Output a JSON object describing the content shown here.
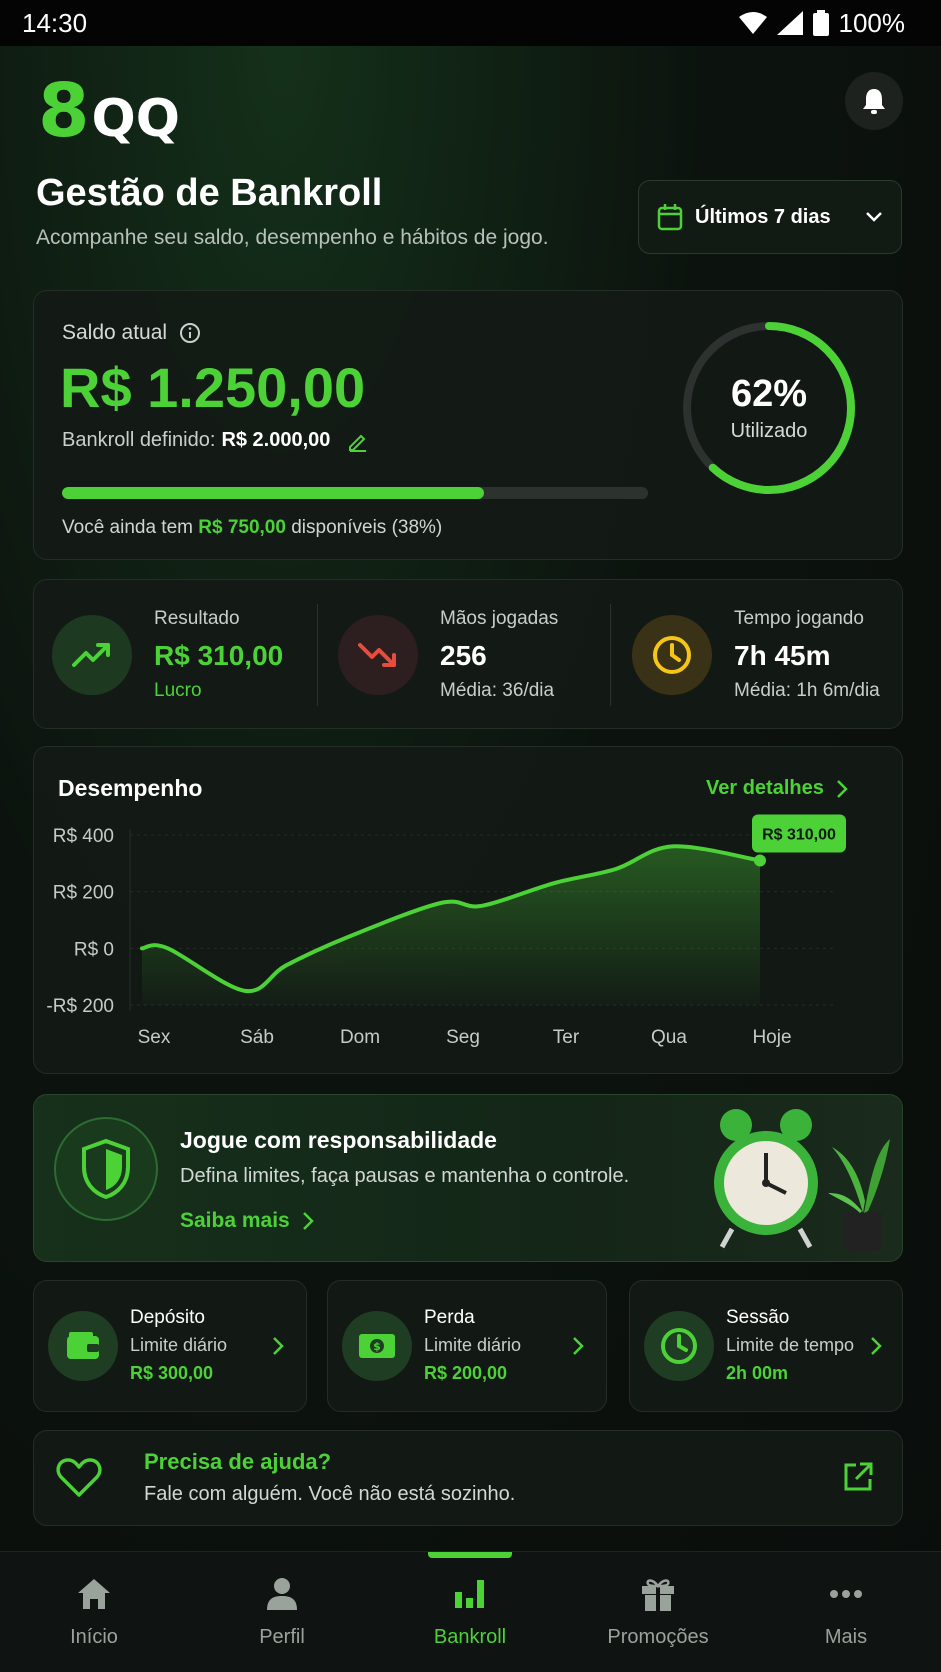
{
  "status_bar": {
    "time": "14:30",
    "battery": "100%"
  },
  "header": {
    "logo_digit": "8",
    "logo_text": "QQ",
    "title": "Gestão de Bankroll",
    "subtitle": "Acompanhe seu saldo, desempenho e hábitos de jogo.",
    "date_filter": "Últimos 7 dias"
  },
  "balance": {
    "label": "Saldo atual",
    "value": "R$ 1.250,00",
    "defined_label": "Bankroll definido:",
    "defined_value": "R$ 2.000,00",
    "progress_fraction": 0.72,
    "remain_prefix": "Você ainda tem",
    "remain_value": "R$ 750,00",
    "remain_suffix": "disponíveis (38%)",
    "ring_fraction": 0.62,
    "ring_percent": "62%",
    "ring_label": "Utilizado"
  },
  "stats": [
    {
      "label": "Resultado",
      "value": "R$ 310,00",
      "sub": "Lucro",
      "icon": "trending-up-icon"
    },
    {
      "label": "Mãos jogadas",
      "value": "256",
      "sub": "Média: 36/dia",
      "icon": "trending-down-icon"
    },
    {
      "label": "Tempo jogando",
      "value": "7h 45m",
      "sub": "Média: 1h 6m/dia",
      "icon": "clock-icon"
    }
  ],
  "performance": {
    "title": "Desempenho",
    "link": "Ver detalhes",
    "tooltip": "R$ 310,00"
  },
  "chart_data": {
    "type": "area",
    "title": "Desempenho",
    "categories": [
      "Sex",
      "Sáb",
      "Dom",
      "Seg",
      "Ter",
      "Qua",
      "Hoje"
    ],
    "y_ticks": [
      "R$ 400",
      "R$ 200",
      "R$ 0",
      "-R$ 200"
    ],
    "ylim": [
      -200,
      400
    ],
    "points": [
      {
        "x": 0,
        "y": 0
      },
      {
        "x": 0.25,
        "y": 0
      },
      {
        "x": 1,
        "y": -150
      },
      {
        "x": 1.4,
        "y": -60
      },
      {
        "x": 2,
        "y": 40
      },
      {
        "x": 2.9,
        "y": 160
      },
      {
        "x": 3.3,
        "y": 150
      },
      {
        "x": 4,
        "y": 230
      },
      {
        "x": 4.6,
        "y": 280
      },
      {
        "x": 5.15,
        "y": 360
      },
      {
        "x": 6,
        "y": 310
      }
    ],
    "series_color": "#4cd137",
    "grid": true
  },
  "responsible": {
    "title": "Jogue com responsabilidade",
    "text": "Defina limites, faça pausas e mantenha o controle.",
    "link": "Saiba mais"
  },
  "limits": [
    {
      "title": "Depósito",
      "sub": "Limite diário",
      "value": "R$ 300,00",
      "icon": "wallet-icon"
    },
    {
      "title": "Perda",
      "sub": "Limite diário",
      "value": "R$ 200,00",
      "icon": "money-icon"
    },
    {
      "title": "Sessão",
      "sub": "Limite de tempo",
      "value": "2h 00m",
      "icon": "clock-icon"
    }
  ],
  "help": {
    "title": "Precisa de ajuda?",
    "text": "Fale com alguém. Você não está sozinho."
  },
  "tabs": [
    {
      "label": "Início",
      "icon": "home-icon"
    },
    {
      "label": "Perfil",
      "icon": "user-icon"
    },
    {
      "label": "Bankroll",
      "icon": "bar-chart-icon",
      "active": true
    },
    {
      "label": "Promoções",
      "icon": "gift-icon"
    },
    {
      "label": "Mais",
      "icon": "more-icon"
    }
  ],
  "colors": {
    "accent": "#4cd137",
    "danger": "#e84c3d",
    "warning": "#f5c518"
  }
}
